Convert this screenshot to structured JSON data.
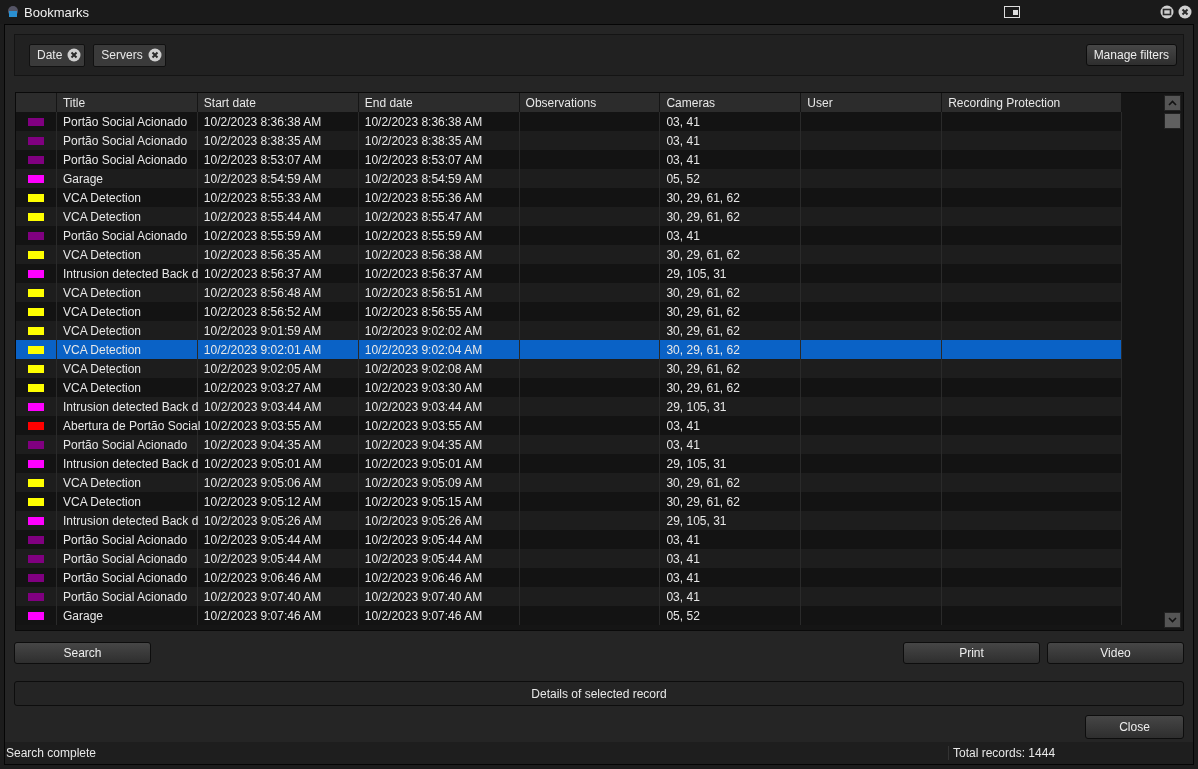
{
  "window": {
    "title": "Bookmarks"
  },
  "filters": [
    {
      "label": "Date"
    },
    {
      "label": "Servers"
    }
  ],
  "manage_filters_button": "Manage filters",
  "table": {
    "columns": [
      "Title",
      "Start date",
      "End date",
      "Observations",
      "Cameras",
      "User",
      "Recording Protection"
    ],
    "rows": [
      {
        "color": "#800080",
        "title": "Portão Social Acionado",
        "start": "10/2/2023 8:36:38 AM",
        "end": "10/2/2023 8:36:38 AM",
        "cameras": "03, 41",
        "selected": false
      },
      {
        "color": "#800080",
        "title": "Portão Social Acionado",
        "start": "10/2/2023 8:38:35 AM",
        "end": "10/2/2023 8:38:35 AM",
        "cameras": "03, 41",
        "selected": false
      },
      {
        "color": "#800080",
        "title": "Portão Social Acionado",
        "start": "10/2/2023 8:53:07 AM",
        "end": "10/2/2023 8:53:07 AM",
        "cameras": "03, 41",
        "selected": false
      },
      {
        "color": "#ff00ff",
        "title": "Garage",
        "start": "10/2/2023 8:54:59 AM",
        "end": "10/2/2023 8:54:59 AM",
        "cameras": "05, 52",
        "selected": false
      },
      {
        "color": "#ffff00",
        "title": "VCA Detection",
        "start": "10/2/2023 8:55:33 AM",
        "end": "10/2/2023 8:55:36 AM",
        "cameras": "30, 29, 61, 62",
        "selected": false
      },
      {
        "color": "#ffff00",
        "title": "VCA Detection",
        "start": "10/2/2023 8:55:44 AM",
        "end": "10/2/2023 8:55:47 AM",
        "cameras": "30, 29, 61, 62",
        "selected": false
      },
      {
        "color": "#800080",
        "title": "Portão Social Acionado",
        "start": "10/2/2023 8:55:59 AM",
        "end": "10/2/2023 8:55:59 AM",
        "cameras": "03, 41",
        "selected": false
      },
      {
        "color": "#ffff00",
        "title": "VCA Detection",
        "start": "10/2/2023 8:56:35 AM",
        "end": "10/2/2023 8:56:38 AM",
        "cameras": "30, 29, 61, 62",
        "selected": false
      },
      {
        "color": "#ff00ff",
        "title": "Intrusion detected Back d",
        "start": "10/2/2023 8:56:37 AM",
        "end": "10/2/2023 8:56:37 AM",
        "cameras": "29, 105, 31",
        "selected": false
      },
      {
        "color": "#ffff00",
        "title": "VCA Detection",
        "start": "10/2/2023 8:56:48 AM",
        "end": "10/2/2023 8:56:51 AM",
        "cameras": "30, 29, 61, 62",
        "selected": false
      },
      {
        "color": "#ffff00",
        "title": "VCA Detection",
        "start": "10/2/2023 8:56:52 AM",
        "end": "10/2/2023 8:56:55 AM",
        "cameras": "30, 29, 61, 62",
        "selected": false
      },
      {
        "color": "#ffff00",
        "title": "VCA Detection",
        "start": "10/2/2023 9:01:59 AM",
        "end": "10/2/2023 9:02:02 AM",
        "cameras": "30, 29, 61, 62",
        "selected": false
      },
      {
        "color": "#ffff00",
        "title": "VCA Detection",
        "start": "10/2/2023 9:02:01 AM",
        "end": "10/2/2023 9:02:04 AM",
        "cameras": "30, 29, 61, 62",
        "selected": true
      },
      {
        "color": "#ffff00",
        "title": "VCA Detection",
        "start": "10/2/2023 9:02:05 AM",
        "end": "10/2/2023 9:02:08 AM",
        "cameras": "30, 29, 61, 62",
        "selected": false
      },
      {
        "color": "#ffff00",
        "title": "VCA Detection",
        "start": "10/2/2023 9:03:27 AM",
        "end": "10/2/2023 9:03:30 AM",
        "cameras": "30, 29, 61, 62",
        "selected": false
      },
      {
        "color": "#ff00ff",
        "title": "Intrusion detected Back d",
        "start": "10/2/2023 9:03:44 AM",
        "end": "10/2/2023 9:03:44 AM",
        "cameras": "29, 105, 31",
        "selected": false
      },
      {
        "color": "#ff0000",
        "title": "Abertura de Portão Social",
        "start": "10/2/2023 9:03:55 AM",
        "end": "10/2/2023 9:03:55 AM",
        "cameras": "03, 41",
        "selected": false
      },
      {
        "color": "#800080",
        "title": "Portão Social Acionado",
        "start": "10/2/2023 9:04:35 AM",
        "end": "10/2/2023 9:04:35 AM",
        "cameras": "03, 41",
        "selected": false
      },
      {
        "color": "#ff00ff",
        "title": "Intrusion detected Back d",
        "start": "10/2/2023 9:05:01 AM",
        "end": "10/2/2023 9:05:01 AM",
        "cameras": "29, 105, 31",
        "selected": false
      },
      {
        "color": "#ffff00",
        "title": "VCA Detection",
        "start": "10/2/2023 9:05:06 AM",
        "end": "10/2/2023 9:05:09 AM",
        "cameras": "30, 29, 61, 62",
        "selected": false
      },
      {
        "color": "#ffff00",
        "title": "VCA Detection",
        "start": "10/2/2023 9:05:12 AM",
        "end": "10/2/2023 9:05:15 AM",
        "cameras": "30, 29, 61, 62",
        "selected": false
      },
      {
        "color": "#ff00ff",
        "title": "Intrusion detected Back d",
        "start": "10/2/2023 9:05:26 AM",
        "end": "10/2/2023 9:05:26 AM",
        "cameras": "29, 105, 31",
        "selected": false
      },
      {
        "color": "#800080",
        "title": "Portão Social Acionado",
        "start": "10/2/2023 9:05:44 AM",
        "end": "10/2/2023 9:05:44 AM",
        "cameras": "03, 41",
        "selected": false
      },
      {
        "color": "#800080",
        "title": "Portão Social Acionado",
        "start": "10/2/2023 9:05:44 AM",
        "end": "10/2/2023 9:05:44 AM",
        "cameras": "03, 41",
        "selected": false
      },
      {
        "color": "#800080",
        "title": "Portão Social Acionado",
        "start": "10/2/2023 9:06:46 AM",
        "end": "10/2/2023 9:06:46 AM",
        "cameras": "03, 41",
        "selected": false
      },
      {
        "color": "#800080",
        "title": "Portão Social Acionado",
        "start": "10/2/2023 9:07:40 AM",
        "end": "10/2/2023 9:07:40 AM",
        "cameras": "03, 41",
        "selected": false
      },
      {
        "color": "#ff00ff",
        "title": "Garage",
        "start": "10/2/2023 9:07:46 AM",
        "end": "10/2/2023 9:07:46 AM",
        "cameras": "05, 52",
        "selected": false
      }
    ]
  },
  "buttons": {
    "search": "Search",
    "print": "Print",
    "video": "Video",
    "close": "Close"
  },
  "details_bar": "Details of selected record",
  "status_bar": {
    "message": "Search complete",
    "total": "Total records: 1444"
  }
}
